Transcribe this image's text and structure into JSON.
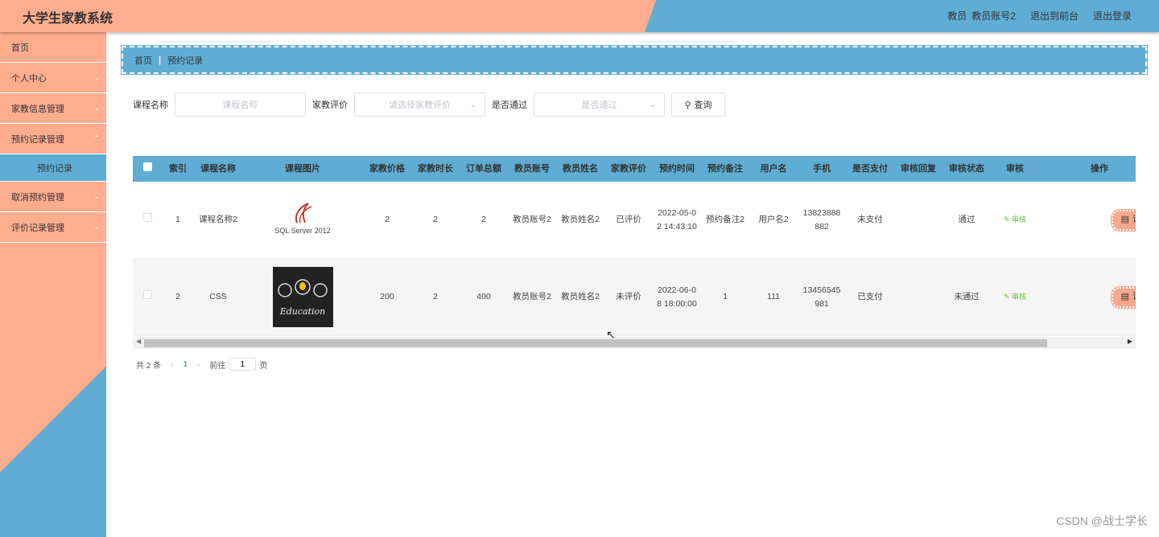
{
  "header": {
    "brand": "大学生家教系统",
    "role": "教员",
    "account": "教员账号2",
    "front_link": "退出到前台",
    "logout": "退出登录"
  },
  "sidebar": {
    "items": [
      {
        "label": "首页"
      },
      {
        "label": "个人中心"
      },
      {
        "label": "家教信息管理"
      },
      {
        "label": "预约记录管理"
      },
      {
        "label": "预约记录"
      },
      {
        "label": "取消预约管理"
      },
      {
        "label": "评价记录管理"
      }
    ]
  },
  "breadcrumb": {
    "home": "首页",
    "current": "预约记录"
  },
  "search": {
    "course_label": "课程名称",
    "course_placeholder": "课程名称",
    "rating_label": "家教评价",
    "rating_placeholder": "请选择家教评价",
    "pass_label": "是否通过",
    "pass_placeholder": "是否通过",
    "query_button": "查询"
  },
  "table": {
    "headers": [
      "索引",
      "课程名称",
      "课程图片",
      "家教价格",
      "家教时长",
      "订单总额",
      "教员账号",
      "教员姓名",
      "家教评价",
      "预约时间",
      "预约备注",
      "用户名",
      "手机",
      "是否支付",
      "审核回复",
      "审核状态",
      "审核",
      "操作"
    ],
    "rows": [
      {
        "index": "1",
        "course": "课程名称2",
        "image_caption": "SQL Server 2012",
        "price": "2",
        "duration": "2",
        "total": "2",
        "teacher_account": "教员账号2",
        "teacher_name": "教员姓名2",
        "rating": "已评价",
        "time": "2022-05-02 14:43:10",
        "note": "预约备注2",
        "username": "用户名2",
        "phone": "13823888882",
        "paid": "未支付",
        "reply": "",
        "status": "通过",
        "audit": "审核",
        "action": "详情"
      },
      {
        "index": "2",
        "course": "CSS",
        "image_caption": "Education",
        "price": "200",
        "duration": "2",
        "total": "400",
        "teacher_account": "教员账号2",
        "teacher_name": "教员姓名2",
        "rating": "未评价",
        "time": "2022-06-08 18:00:00",
        "note": "1",
        "username": "111",
        "phone": "13456545981",
        "paid": "已支付",
        "reply": "",
        "status": "未通过",
        "audit": "审核",
        "action": "详情"
      }
    ]
  },
  "pager": {
    "total_prefix": "共",
    "total": "2",
    "total_suffix": "条",
    "page": "1",
    "goto_label": "前往",
    "goto_value": "1",
    "goto_suffix": "页"
  },
  "watermark": "CSDN @战士学长"
}
